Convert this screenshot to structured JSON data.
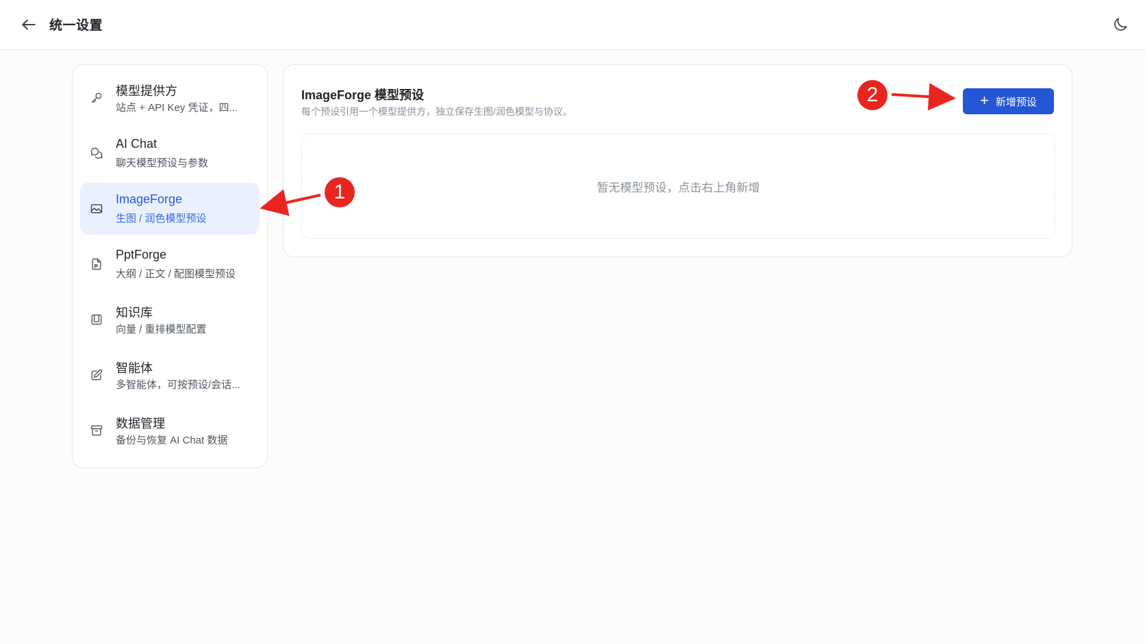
{
  "header": {
    "title": "统一设置",
    "back_icon": "arrow-left-icon",
    "theme_icon": "moon-icon"
  },
  "sidebar": {
    "items": [
      {
        "label": "模型提供方",
        "sub": "站点 + API Key 凭证，四...",
        "icon": "key-icon"
      },
      {
        "label": "AI Chat",
        "sub": "聊天模型预设与参数",
        "icon": "chat-bubbles-icon"
      },
      {
        "label": "ImageForge",
        "sub": "生图 / 润色模型预设",
        "icon": "image-icon",
        "active": true
      },
      {
        "label": "PptForge",
        "sub": "大纲 / 正文 / 配图模型预设",
        "icon": "document-icon"
      },
      {
        "label": "知识库",
        "sub": "向量 / 重排模型配置",
        "icon": "book-icon"
      },
      {
        "label": "智能体",
        "sub": "多智能体，可按预设/会话...",
        "icon": "pencil-icon"
      },
      {
        "label": "数据管理",
        "sub": "备份与恢复 AI Chat 数据",
        "icon": "archive-icon"
      }
    ]
  },
  "main": {
    "title": "ImageForge 模型预设",
    "description": "每个预设引用一个模型提供方，独立保存生图/润色模型与协议。",
    "add_button": {
      "icon": "+",
      "label": "新增预设"
    },
    "empty_text": "暂无模型预设，点击右上角新增"
  },
  "annotations": {
    "badge_1": "1",
    "badge_2": "2",
    "color": "#e8261f"
  },
  "colors": {
    "accent": "#2456d6",
    "active_bg": "#eaf0fd",
    "active_text": "#2a5bd7"
  }
}
